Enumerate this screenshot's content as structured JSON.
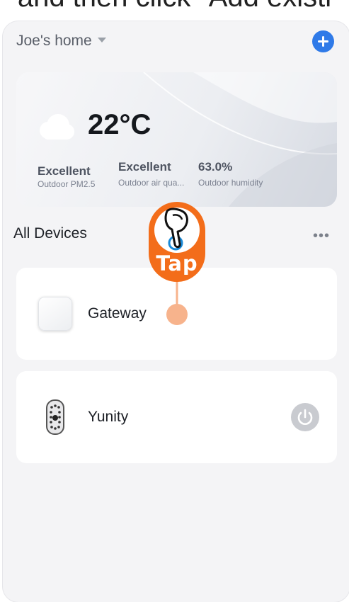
{
  "caption": {
    "text": "and then click \"Add existi"
  },
  "header": {
    "home_name": "Joe's home",
    "add_icon": "plus-icon",
    "add_color": "#2f7ae8"
  },
  "weather": {
    "icon": "cloud-icon",
    "temperature": "22°C",
    "stats": [
      {
        "value": "Excellent",
        "label": "Outdoor PM2.5"
      },
      {
        "value": "Excellent",
        "label": "Outdoor air qua..."
      },
      {
        "value": "63.0%",
        "label": "Outdoor humidity"
      }
    ]
  },
  "devices_section": {
    "title": "All Devices",
    "more_label": "•••"
  },
  "devices": [
    {
      "name": "Gateway",
      "icon": "gateway-icon"
    },
    {
      "name": "Yunity",
      "icon": "smart-lock-icon",
      "power_icon": "power-icon"
    }
  ],
  "tap_hint": {
    "label": "Tap",
    "icon": "hand-pointer-icon",
    "color": "#f36d1a"
  }
}
